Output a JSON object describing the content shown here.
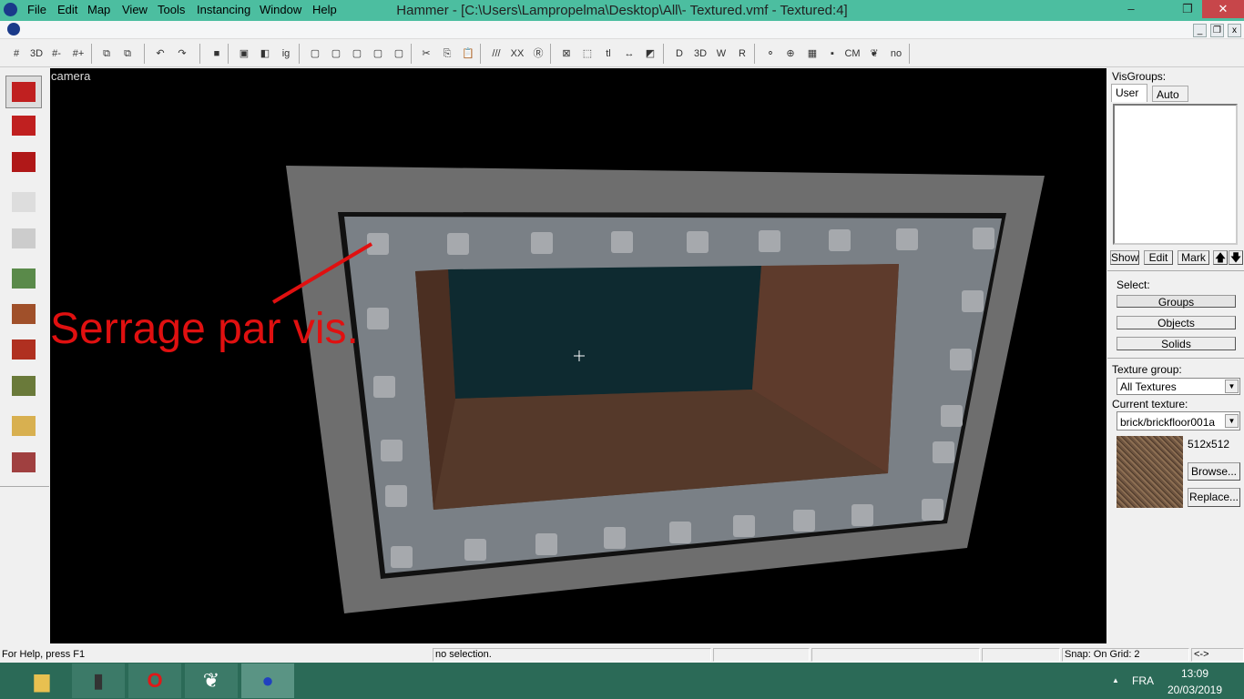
{
  "window": {
    "title": "Hammer - [C:\\Users\\Lampropelma\\Desktop\\All\\- Textured.vmf - Textured:4]",
    "minimize": "–",
    "restore": "❐",
    "close": "✕"
  },
  "menu": [
    "File",
    "Edit",
    "Map",
    "View",
    "Tools",
    "Instancing",
    "Window",
    "Help"
  ],
  "mdi_buttons": [
    "_",
    "❐",
    "x"
  ],
  "toolbar": [
    {
      "icon": "grid-icon",
      "g": "#"
    },
    {
      "icon": "3d-grid-icon",
      "g": "3D"
    },
    {
      "icon": "smaller-grid-icon",
      "g": "#-"
    },
    {
      "icon": "larger-grid-icon",
      "g": "#+"
    },
    {
      "icon": "carve-icon",
      "g": "⧉"
    },
    {
      "icon": "group-icon",
      "g": "⧉"
    },
    {
      "icon": "undo-icon",
      "g": "↶"
    },
    {
      "icon": "redo-icon",
      "g": "↷"
    },
    {
      "icon": "hide-icon",
      "g": "■"
    },
    {
      "icon": "group-objects-icon",
      "g": "▣"
    },
    {
      "icon": "ungroup-icon",
      "g": "◧"
    },
    {
      "icon": "ignore-groups-icon",
      "g": "ig"
    },
    {
      "icon": "hide-selected-icon",
      "g": "▢"
    },
    {
      "icon": "hide-unselected-icon",
      "g": "▢"
    },
    {
      "icon": "show-all-icon",
      "g": "▢"
    },
    {
      "icon": "cordon-icon",
      "g": "▢"
    },
    {
      "icon": "cordon-hide-icon",
      "g": "▢"
    },
    {
      "icon": "cut-icon",
      "g": "✂"
    },
    {
      "icon": "copy-icon",
      "g": "⎘"
    },
    {
      "icon": "paste-icon",
      "g": "📋"
    },
    {
      "icon": "toggle-texture-lock-icon",
      "g": "///"
    },
    {
      "icon": "texture-scaling-lock-icon",
      "g": "XX"
    },
    {
      "icon": "radius-culling-icon",
      "g": "Ⓡ"
    },
    {
      "icon": "selection-box-icon",
      "g": "⊠"
    },
    {
      "icon": "select-by-handle-icon",
      "g": "⬚"
    },
    {
      "icon": "texture-lock-icon",
      "g": "tl"
    },
    {
      "icon": "transform-icon",
      "g": "↔"
    },
    {
      "icon": "flip-icon",
      "g": "◩"
    },
    {
      "icon": "toggle-2d-models-icon",
      "g": "D"
    },
    {
      "icon": "3d-models-icon",
      "g": "3D"
    },
    {
      "icon": "toggle-wireframe-icon",
      "g": "W"
    },
    {
      "icon": "toggle-render-icon",
      "g": "R"
    },
    {
      "icon": "helpers-icon",
      "g": "⚬"
    },
    {
      "icon": "entity-icon",
      "g": "⊕"
    },
    {
      "icon": "toggle-grid-icon",
      "g": "▦"
    },
    {
      "icon": "toggle-cordon-icon",
      "g": "▪"
    },
    {
      "icon": "cubemap-icon",
      "g": "CM"
    },
    {
      "icon": "leaf-icon",
      "g": "❦"
    },
    {
      "icon": "nodraw-icon",
      "g": "no"
    }
  ],
  "tools": [
    "selection-tool",
    "magnify-tool",
    "camera-tool",
    "entity-tool",
    "block-tool",
    "texture-application-tool",
    "apply-texture-tool",
    "decal-tool",
    "overlay-tool",
    "clipping-tool",
    "vertex-tool"
  ],
  "viewport": {
    "label": "camera",
    "annotation": "Serrage par vis."
  },
  "right_panel": {
    "visgroups_label": "VisGroups:",
    "tabs": [
      "User",
      "Auto"
    ],
    "buttons": {
      "show": "Show",
      "edit": "Edit",
      "mark": "Mark",
      "up": "🡅",
      "down": "🡇"
    },
    "select_label": "Select:",
    "select_buttons": [
      "Groups",
      "Objects",
      "Solids"
    ],
    "texture_group_label": "Texture group:",
    "texture_group": "All Textures",
    "current_texture_label": "Current texture:",
    "current_texture": "brick/brickfloor001a",
    "texture_size": "512x512",
    "browse": "Browse...",
    "replace": "Replace..."
  },
  "status": {
    "help": "For Help, press F1",
    "selection": "no selection.",
    "snap": "Snap: On Grid: 2",
    "arrows": "<->"
  },
  "taskbar": {
    "apps": [
      "file-explorer",
      "mouse-app",
      "opera-browser",
      "app-drill",
      "hammer-editor"
    ],
    "lang": "FRA",
    "time": "13:09",
    "date": "20/03/2019",
    "tray_arrow": "▲"
  },
  "colors": {
    "titlebar": "#4cbea0",
    "taskbar": "#2b6a57",
    "annotation": "#e01010"
  }
}
